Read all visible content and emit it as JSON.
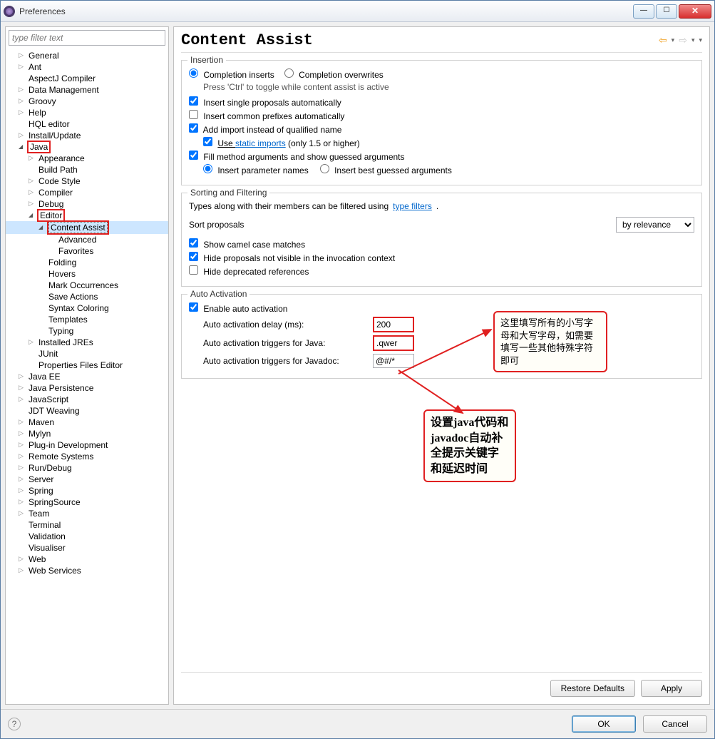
{
  "window": {
    "title": "Preferences"
  },
  "filter": {
    "placeholder": "type filter text"
  },
  "tree": [
    {
      "label": "General",
      "depth": 1,
      "arrow": "collapsed"
    },
    {
      "label": "Ant",
      "depth": 1,
      "arrow": "collapsed"
    },
    {
      "label": "AspectJ Compiler",
      "depth": 1,
      "arrow": "none"
    },
    {
      "label": "Data Management",
      "depth": 1,
      "arrow": "collapsed"
    },
    {
      "label": "Groovy",
      "depth": 1,
      "arrow": "collapsed"
    },
    {
      "label": "Help",
      "depth": 1,
      "arrow": "collapsed"
    },
    {
      "label": "HQL editor",
      "depth": 1,
      "arrow": "none"
    },
    {
      "label": "Install/Update",
      "depth": 1,
      "arrow": "collapsed"
    },
    {
      "label": "Java",
      "depth": 1,
      "arrow": "expanded",
      "red": true
    },
    {
      "label": "Appearance",
      "depth": 2,
      "arrow": "collapsed"
    },
    {
      "label": "Build Path",
      "depth": 2,
      "arrow": "none"
    },
    {
      "label": "Code Style",
      "depth": 2,
      "arrow": "collapsed"
    },
    {
      "label": "Compiler",
      "depth": 2,
      "arrow": "collapsed"
    },
    {
      "label": "Debug",
      "depth": 2,
      "arrow": "collapsed"
    },
    {
      "label": "Editor",
      "depth": 2,
      "arrow": "expanded",
      "red": true
    },
    {
      "label": "Content Assist",
      "depth": 3,
      "arrow": "expanded",
      "selected": true,
      "red": true
    },
    {
      "label": "Advanced",
      "depth": 4,
      "arrow": "none"
    },
    {
      "label": "Favorites",
      "depth": 4,
      "arrow": "none"
    },
    {
      "label": "Folding",
      "depth": 3,
      "arrow": "none"
    },
    {
      "label": "Hovers",
      "depth": 3,
      "arrow": "none"
    },
    {
      "label": "Mark Occurrences",
      "depth": 3,
      "arrow": "none"
    },
    {
      "label": "Save Actions",
      "depth": 3,
      "arrow": "none"
    },
    {
      "label": "Syntax Coloring",
      "depth": 3,
      "arrow": "none"
    },
    {
      "label": "Templates",
      "depth": 3,
      "arrow": "none"
    },
    {
      "label": "Typing",
      "depth": 3,
      "arrow": "none"
    },
    {
      "label": "Installed JREs",
      "depth": 2,
      "arrow": "collapsed"
    },
    {
      "label": "JUnit",
      "depth": 2,
      "arrow": "none"
    },
    {
      "label": "Properties Files Editor",
      "depth": 2,
      "arrow": "none"
    },
    {
      "label": "Java EE",
      "depth": 1,
      "arrow": "collapsed"
    },
    {
      "label": "Java Persistence",
      "depth": 1,
      "arrow": "collapsed"
    },
    {
      "label": "JavaScript",
      "depth": 1,
      "arrow": "collapsed"
    },
    {
      "label": "JDT Weaving",
      "depth": 1,
      "arrow": "none"
    },
    {
      "label": "Maven",
      "depth": 1,
      "arrow": "collapsed"
    },
    {
      "label": "Mylyn",
      "depth": 1,
      "arrow": "collapsed"
    },
    {
      "label": "Plug-in Development",
      "depth": 1,
      "arrow": "collapsed"
    },
    {
      "label": "Remote Systems",
      "depth": 1,
      "arrow": "collapsed"
    },
    {
      "label": "Run/Debug",
      "depth": 1,
      "arrow": "collapsed"
    },
    {
      "label": "Server",
      "depth": 1,
      "arrow": "collapsed"
    },
    {
      "label": "Spring",
      "depth": 1,
      "arrow": "collapsed"
    },
    {
      "label": "SpringSource",
      "depth": 1,
      "arrow": "collapsed"
    },
    {
      "label": "Team",
      "depth": 1,
      "arrow": "collapsed"
    },
    {
      "label": "Terminal",
      "depth": 1,
      "arrow": "none"
    },
    {
      "label": "Validation",
      "depth": 1,
      "arrow": "none"
    },
    {
      "label": "Visualiser",
      "depth": 1,
      "arrow": "none"
    },
    {
      "label": "Web",
      "depth": 1,
      "arrow": "collapsed"
    },
    {
      "label": "Web Services",
      "depth": 1,
      "arrow": "collapsed"
    }
  ],
  "page": {
    "title": "Content Assist"
  },
  "insertion": {
    "group": "Insertion",
    "completion_inserts": "Completion inserts",
    "completion_overwrites": "Completion overwrites",
    "toggle_hint": "Press 'Ctrl' to toggle while content assist is active",
    "insert_single": "Insert single proposals automatically",
    "insert_common": "Insert common prefixes automatically",
    "add_import": "Add import instead of qualified name",
    "use_static_prefix": "Use ",
    "use_static_link": "static imports",
    "use_static_suffix": " (only 1.5 or higher)",
    "fill_method": "Fill method arguments and show guessed arguments",
    "insert_param_names": "Insert parameter names",
    "insert_best_guessed": "Insert best guessed arguments"
  },
  "sorting": {
    "group": "Sorting and Filtering",
    "filter_text_prefix": "Types along with their members can be filtered using ",
    "filter_link": "type filters",
    "filter_text_suffix": ".",
    "sort_label": "Sort proposals",
    "sort_value": "by relevance",
    "camel": "Show camel case matches",
    "hide_invisible": "Hide proposals not visible in the invocation context",
    "hide_deprecated": "Hide deprecated references"
  },
  "auto": {
    "group": "Auto Activation",
    "enable": "Enable auto activation",
    "delay_label": "Auto activation delay (ms):",
    "delay_value": "200",
    "java_label": "Auto activation triggers for Java:",
    "java_value": ".qwer",
    "javadoc_label": "Auto activation triggers for Javadoc:",
    "javadoc_value": "@#/*"
  },
  "annotations": {
    "a1": "这里填写所有的小写字母和大写字母，如需要填写一些其他特殊字符即可",
    "a2": "设置java代码和javadoc自动补全提示关键字和延迟时间"
  },
  "buttons": {
    "restore": "Restore Defaults",
    "apply": "Apply",
    "ok": "OK",
    "cancel": "Cancel"
  }
}
